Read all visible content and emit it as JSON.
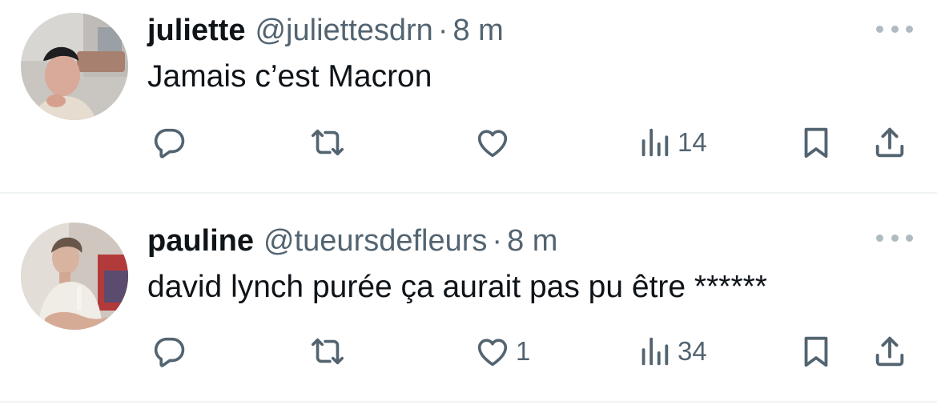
{
  "colors": {
    "primary_text": "#0f1419",
    "secondary_text": "#536471",
    "divider": "#eff3f4"
  },
  "tweets": [
    {
      "display_name": "juliette",
      "handle": "@juliettesdrn",
      "separator": "·",
      "time": "8 m",
      "text": "Jamais c’est Macron",
      "actions": {
        "reply_icon": "reply-icon",
        "repost_icon": "repost-icon",
        "like_icon": "heart-icon",
        "likes": "",
        "views_icon": "views-chart-icon",
        "views": "14",
        "bookmark_icon": "bookmark-icon",
        "share_icon": "share-icon"
      }
    },
    {
      "display_name": "pauline",
      "handle": "@tueursdefleurs",
      "separator": "·",
      "time": "8 m",
      "text": "david lynch purée ça aurait pas pu être ******",
      "actions": {
        "reply_icon": "reply-icon",
        "repost_icon": "repost-icon",
        "like_icon": "heart-icon",
        "likes": "1",
        "views_icon": "views-chart-icon",
        "views": "34",
        "bookmark_icon": "bookmark-icon",
        "share_icon": "share-icon"
      }
    }
  ]
}
